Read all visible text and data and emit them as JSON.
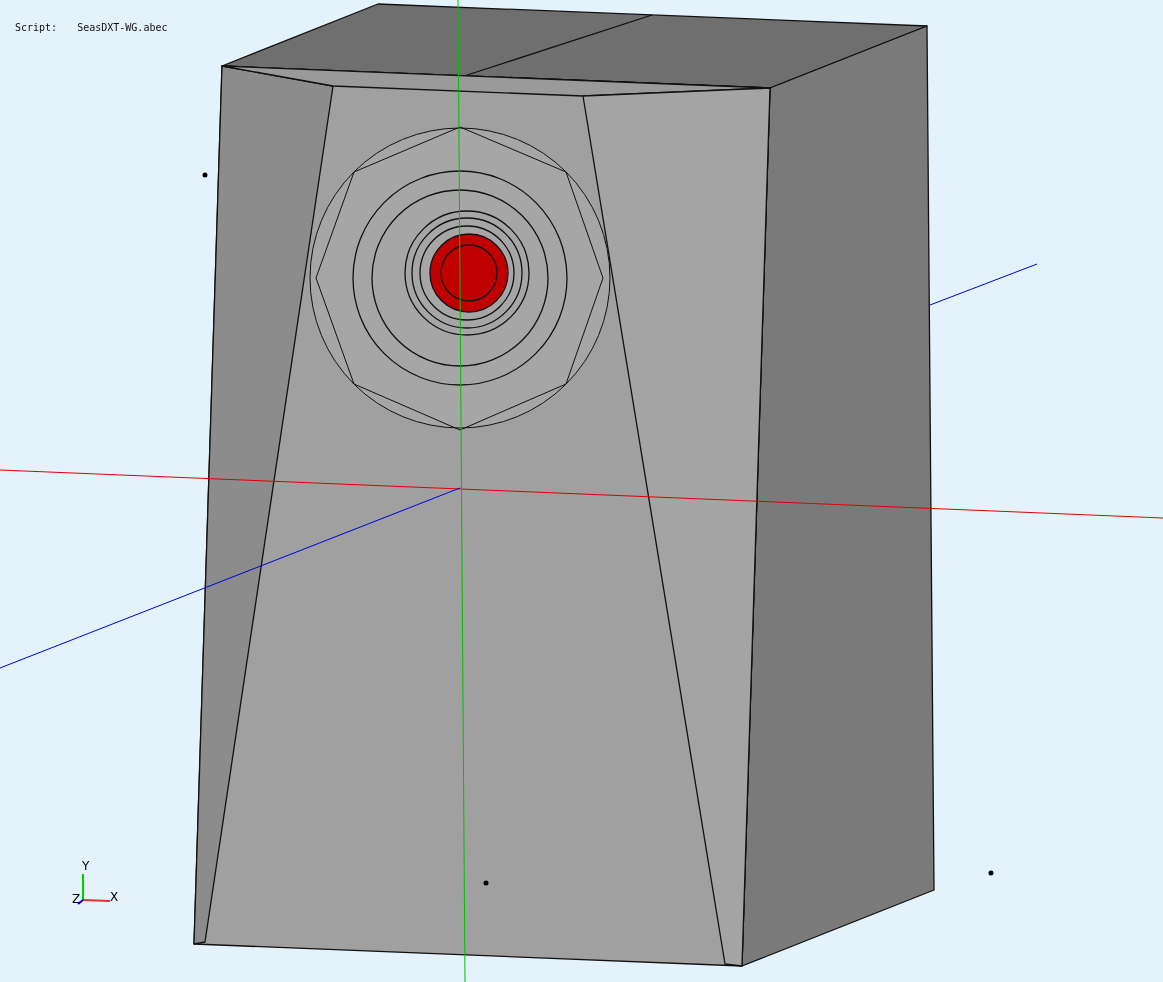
{
  "script": {
    "label": "Script:",
    "file": "SeasDXT-WG.abec"
  },
  "axis_triad": {
    "labels": [
      {
        "kind": "vertical",
        "text": "Y"
      },
      {
        "kind": "depth",
        "text": "Z"
      },
      {
        "kind": "horizontal",
        "text": "X"
      }
    ]
  }
}
